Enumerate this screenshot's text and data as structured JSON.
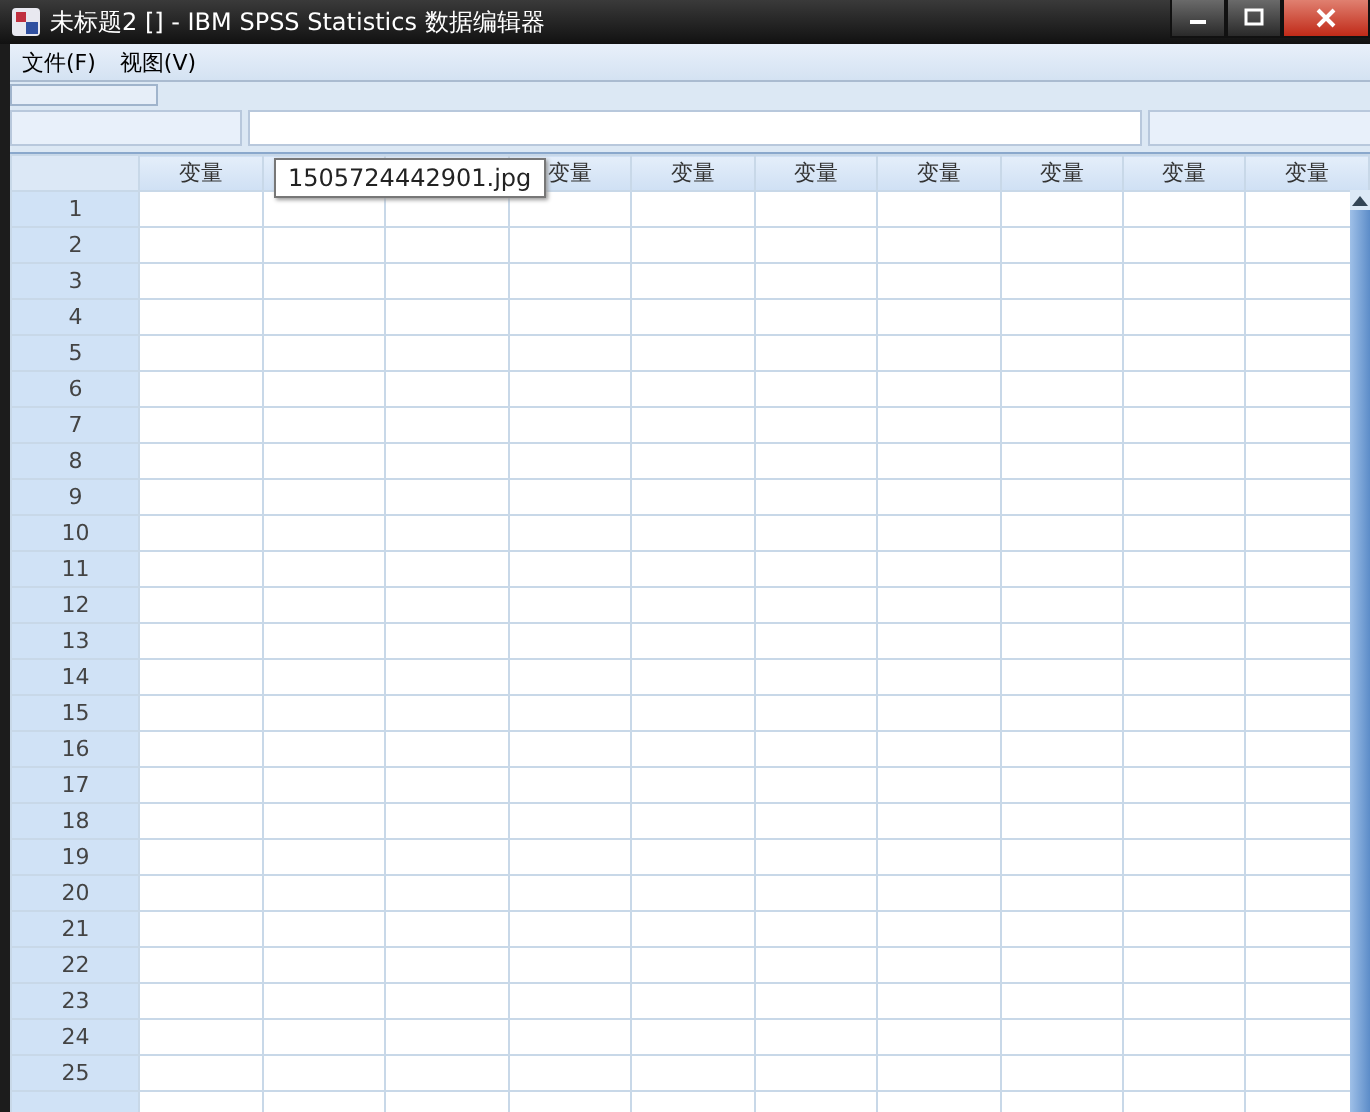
{
  "window": {
    "title": "未标题2 [] - IBM SPSS Statistics 数据编辑器"
  },
  "menu": [
    {
      "label": "文件(F)"
    },
    {
      "label": "视图(V)"
    }
  ],
  "table": {
    "columns": [
      {
        "label": "变量"
      },
      {},
      {},
      {
        "label": "变量"
      },
      {
        "label": "变量"
      },
      {
        "label": "变量"
      },
      {
        "label": "变量"
      },
      {
        "label": "变量"
      },
      {
        "label": "变量"
      },
      {
        "label": "变量"
      }
    ],
    "rows": [
      "1",
      "2",
      "3",
      "4",
      "5",
      "6",
      "7",
      "8",
      "9",
      "10",
      "11",
      "12",
      "13",
      "14",
      "15",
      "16",
      "17",
      "18",
      "19",
      "20",
      "21",
      "22",
      "23",
      "24",
      "25"
    ]
  },
  "tooltip": {
    "text": "1505724442901.jpg"
  }
}
